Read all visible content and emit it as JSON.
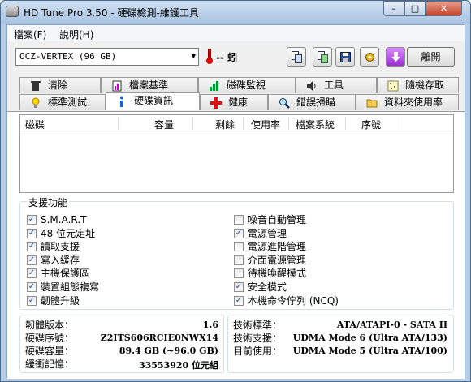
{
  "window": {
    "title": "HD Tune Pro 3.50 - 硬碟檢測-維護工具",
    "minimize": "–",
    "maximize": "□",
    "close": "✕"
  },
  "menu": {
    "file": "檔案(F)",
    "help": "說明(H)"
  },
  "toolbar": {
    "drive": "OCZ-VERTEX (96 GB)",
    "temperature": "-- 蚓",
    "exit_label": "離開",
    "icons": [
      "copy-text-icon",
      "copy-screenshot-icon",
      "save-icon",
      "options-icon",
      "down-arrow-icon"
    ]
  },
  "tabs": {
    "row1": [
      "清除",
      "檔案基準",
      "磁碟監視",
      "工具",
      "隨機存取"
    ],
    "row2": [
      "標準測試",
      "硬碟資訊",
      "健康",
      "錯誤掃瞄",
      "資料夾使用率"
    ],
    "selected": "硬碟資訊"
  },
  "partition_table": {
    "columns": [
      "磁碟",
      "容量",
      "剩餘",
      "使用率",
      "檔案系統",
      "序號"
    ],
    "rows": []
  },
  "features": {
    "title": "支援功能",
    "left": [
      {
        "label": "S.M.A.R.T",
        "checked": true
      },
      {
        "label": "48 位元定址",
        "checked": true
      },
      {
        "label": "讀取支援",
        "checked": true
      },
      {
        "label": "寫入緩存",
        "checked": true
      },
      {
        "label": "主機保護區",
        "checked": true
      },
      {
        "label": "裝置組態複寫",
        "checked": true
      },
      {
        "label": "韌體升級",
        "checked": true
      }
    ],
    "right": [
      {
        "label": "噪音自動管理",
        "checked": false
      },
      {
        "label": "電源管理",
        "checked": true
      },
      {
        "label": "電源進階管理",
        "checked": false
      },
      {
        "label": "介面電源管理",
        "checked": false
      },
      {
        "label": "待機喚醒模式",
        "checked": false
      },
      {
        "label": "安全模式",
        "checked": true
      },
      {
        "label": "本機命令佇列 (NCQ)",
        "checked": true
      }
    ]
  },
  "info": {
    "left": [
      {
        "label": "韌體版本：",
        "value": "1.6"
      },
      {
        "label": "硬碟序號：",
        "value": "Z2ITS606RCIE0NWX14"
      },
      {
        "label": "硬碟容量：",
        "value": "89.4 GB (~96.0 GB)"
      },
      {
        "label": "緩衝記憶：",
        "value": "33553920 位元組"
      }
    ],
    "right": [
      {
        "label": "技術標準：",
        "value": "ATA/ATAPI-0 - SATA II"
      },
      {
        "label": "技術支援：",
        "value": "UDMA Mode 6 (Ultra ATA/133)"
      },
      {
        "label": "目前使用：",
        "value": "UDMA Mode 5 (Ultra ATA/100)"
      }
    ]
  }
}
